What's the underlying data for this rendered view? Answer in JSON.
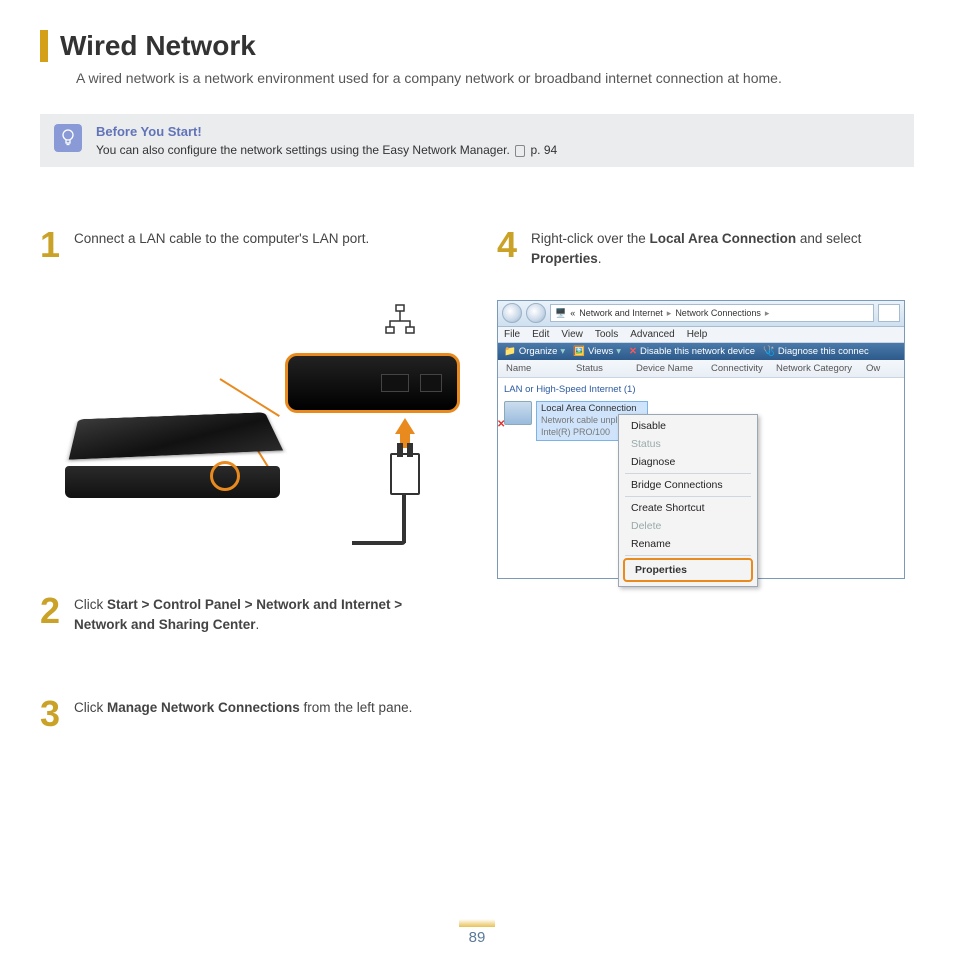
{
  "title": "Wired Network",
  "intro": "A wired network is a network environment used for a company network or broadband internet connection at home.",
  "tip": {
    "heading": "Before You Start!",
    "text_a": "You can also configure the network settings using the Easy Network Manager. ",
    "text_b": " p. 94"
  },
  "steps": {
    "s1": {
      "num": "1",
      "text": "Connect a LAN cable to the computer's LAN port."
    },
    "s2": {
      "num": "2",
      "pre": "Click ",
      "bold": "Start > Control Panel > Network and Internet > Network and Sharing Center",
      "post": "."
    },
    "s3": {
      "num": "3",
      "pre": "Click ",
      "bold": "Manage Network Connections",
      "post": " from the left pane."
    },
    "s4": {
      "num": "4",
      "pre": "Right-click over the ",
      "bold1": "Local Area Connection",
      "mid": " and select ",
      "bold2": "Properties",
      "post": "."
    }
  },
  "win": {
    "breadcrumb": {
      "a": "Network and Internet",
      "b": "Network Connections"
    },
    "menu": [
      "File",
      "Edit",
      "View",
      "Tools",
      "Advanced",
      "Help"
    ],
    "toolbar": {
      "organize": "Organize",
      "views": "Views",
      "disable": "Disable this network device",
      "diagnose": "Diagnose this connec"
    },
    "columns": [
      "Name",
      "Status",
      "Device Name",
      "Connectivity",
      "Network Category",
      "Ow"
    ],
    "group": "LAN or High-Speed Internet (1)",
    "conn": {
      "title": "Local Area Connection",
      "sub1": "Network cable unplugged",
      "sub2": "Intel(R) PRO/100"
    },
    "ctx": {
      "disable": "Disable",
      "status": "Status",
      "diagnose": "Diagnose",
      "bridge": "Bridge Connections",
      "shortcut": "Create Shortcut",
      "delete": "Delete",
      "rename": "Rename",
      "properties": "Properties"
    }
  },
  "page_number": "89"
}
